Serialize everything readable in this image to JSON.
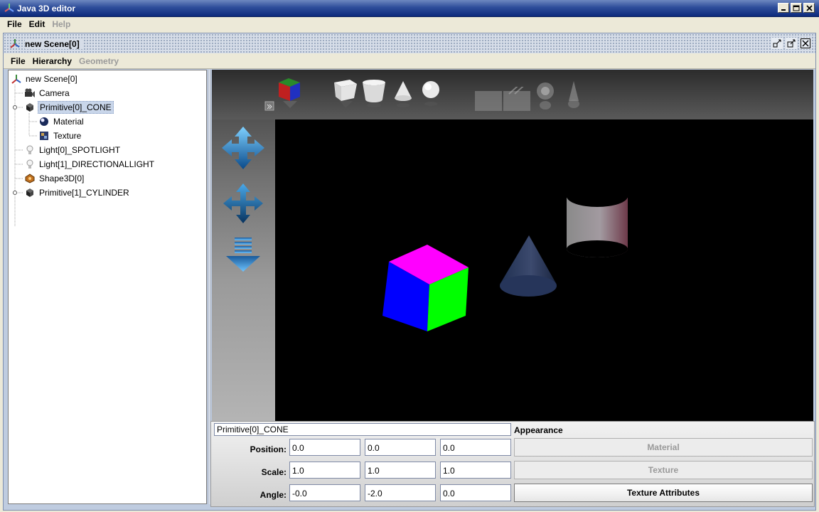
{
  "window": {
    "title": "Java 3D editor",
    "menu": [
      {
        "label": "File",
        "enabled": true
      },
      {
        "label": "Edit",
        "enabled": true
      },
      {
        "label": "Help",
        "enabled": false
      }
    ]
  },
  "scene_frame": {
    "title": "new Scene[0]",
    "menu": [
      {
        "label": "File",
        "enabled": true
      },
      {
        "label": "Hierarchy",
        "enabled": true
      },
      {
        "label": "Geometry",
        "enabled": false
      }
    ]
  },
  "tree": {
    "nodes": [
      {
        "label": "new Scene[0]",
        "icon": "scene-axes-icon"
      },
      {
        "label": "Camera",
        "icon": "camera-icon"
      },
      {
        "label": "Primitive[0]_CONE",
        "icon": "primitive-cube-icon",
        "selected": true
      },
      {
        "label": "Material",
        "icon": "material-icon"
      },
      {
        "label": "Texture",
        "icon": "texture-icon"
      },
      {
        "label": "Light[0]_SPOTLIGHT",
        "icon": "lightbulb-icon"
      },
      {
        "label": "Light[1]_DIRECTIONALLIGHT",
        "icon": "lightbulb-icon"
      },
      {
        "label": "Shape3D[0]",
        "icon": "shape3d-icon"
      },
      {
        "label": "Primitive[1]_CYLINDER",
        "icon": "primitive-cube-icon"
      }
    ]
  },
  "toolbar": {
    "top_icons": [
      "color-cube-icon",
      "box-icon",
      "cylinder-icon",
      "cone-icon",
      "sphere-icon",
      "plane-icon",
      "plane-textured-icon",
      "point-light-icon",
      "spot-light-icon"
    ],
    "left_icons": [
      "move-xz-icon",
      "move-xy-icon",
      "move-down-icon"
    ]
  },
  "properties": {
    "name": "Primitive[0]_CONE",
    "appearance_label": "Appearance",
    "position": {
      "label": "Position:",
      "values": [
        "0.0",
        "0.0",
        "0.0"
      ]
    },
    "scale": {
      "label": "Scale:",
      "values": [
        "1.0",
        "1.0",
        "1.0"
      ]
    },
    "angle": {
      "label": "Angle:",
      "values": [
        "-0.0",
        "-2.0",
        "0.0"
      ]
    },
    "buttons": [
      {
        "label": "Material",
        "enabled": false
      },
      {
        "label": "Texture",
        "enabled": false
      },
      {
        "label": "Texture Attributes",
        "enabled": true
      }
    ]
  },
  "colors": {
    "titlebar": "#0c2a7c",
    "selection": "#c9d6ea",
    "cube_top": "#ff00ff",
    "cube_left": "#0000ff",
    "cube_right": "#00ff00"
  }
}
